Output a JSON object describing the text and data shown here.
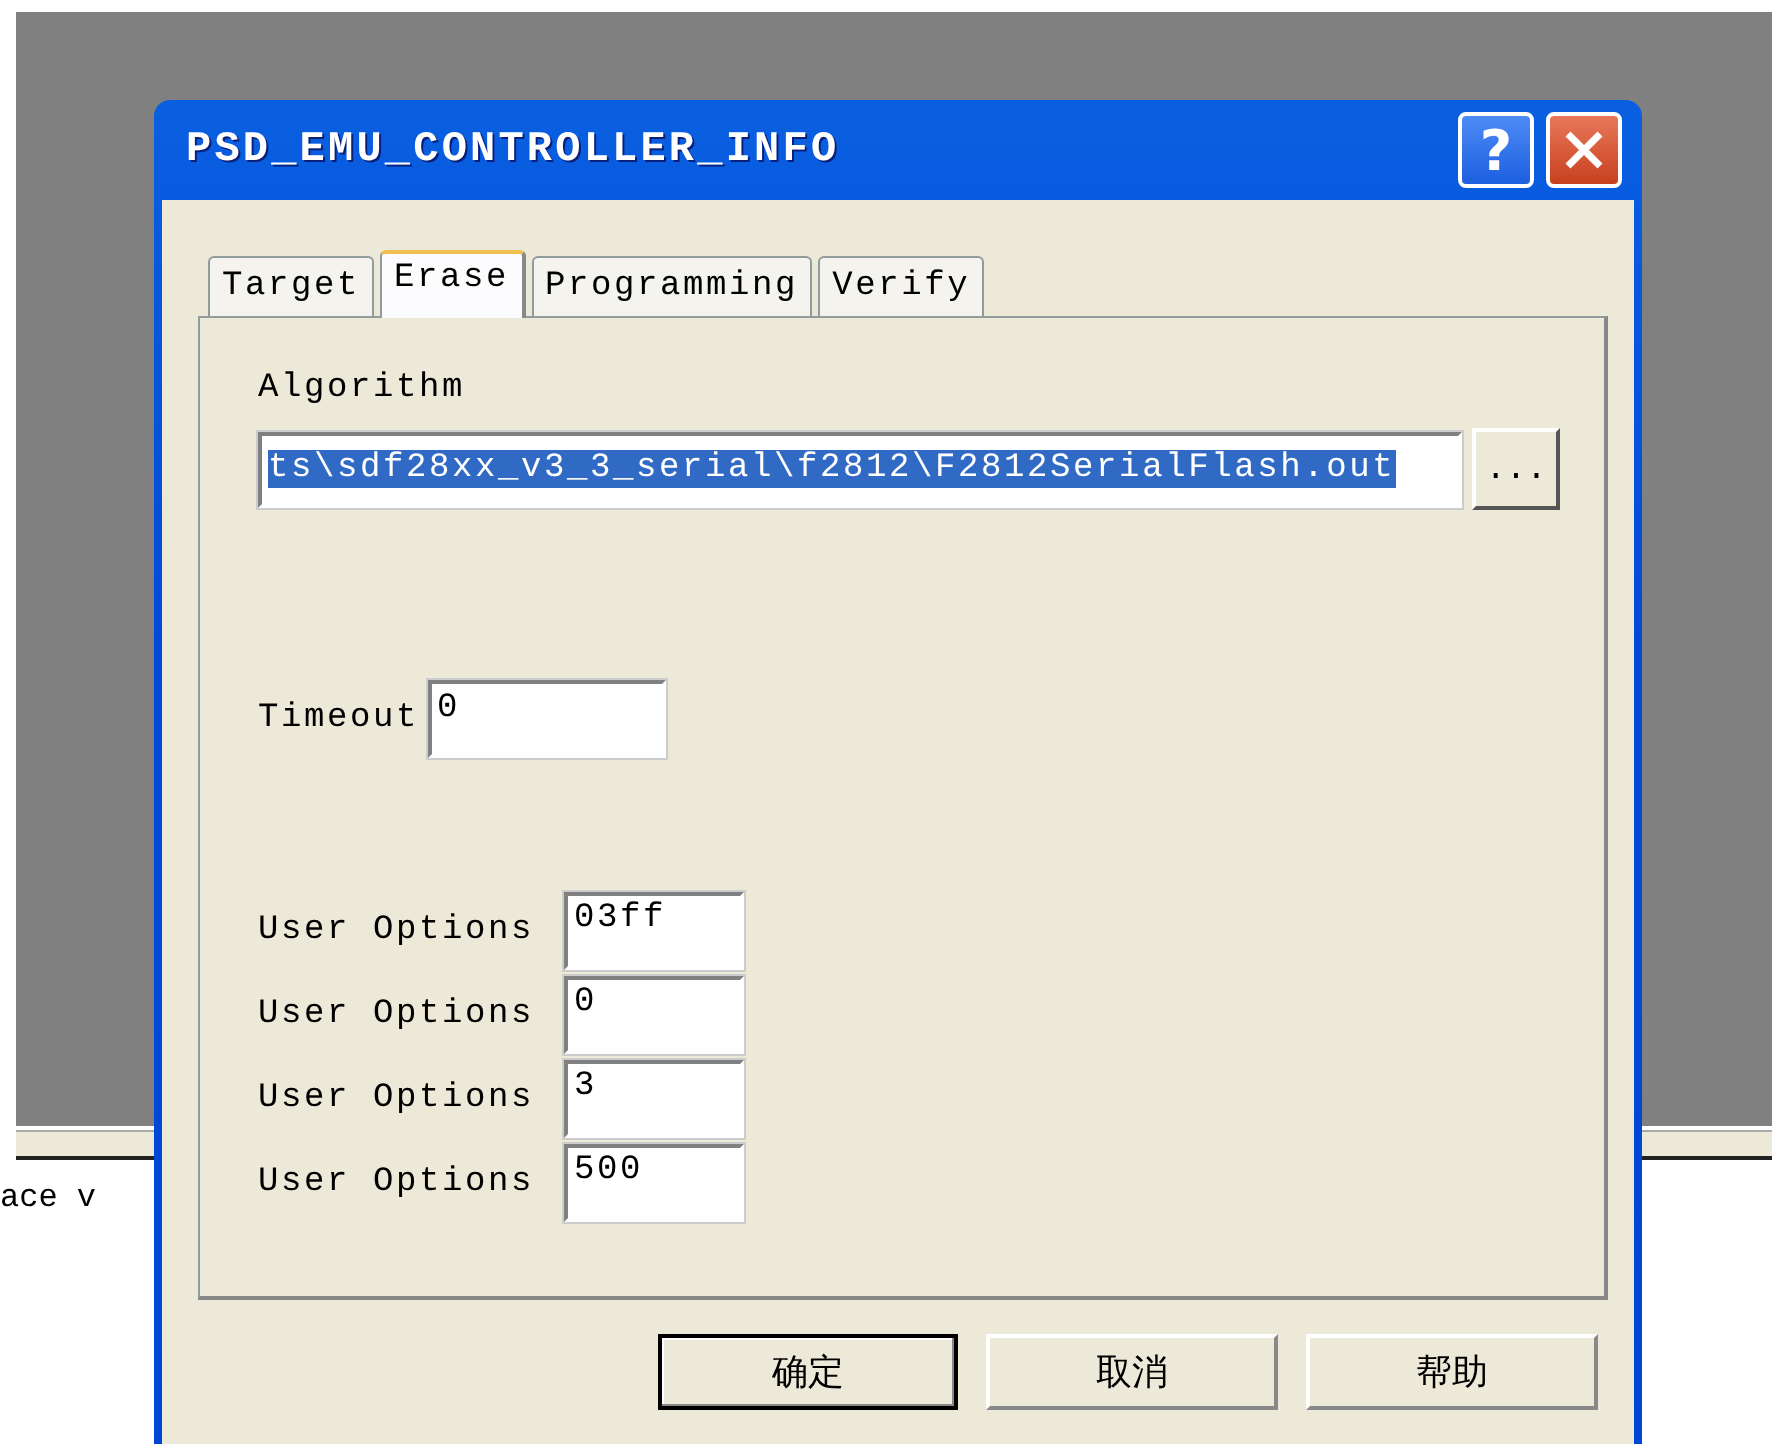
{
  "background": {
    "text": "ace v"
  },
  "window": {
    "title": "PSD_EMU_CONTROLLER_INFO",
    "help": "?"
  },
  "tabs": [
    {
      "label": "Target",
      "selected": false
    },
    {
      "label": "Erase",
      "selected": true
    },
    {
      "label": "Programming",
      "selected": false
    },
    {
      "label": "Verify",
      "selected": false
    }
  ],
  "algorithm": {
    "label": "Algorithm",
    "value": "ts\\sdf28xx_v3_3_serial\\f2812\\F2812SerialFlash.out",
    "text_selected": true,
    "browse": "..."
  },
  "timeout": {
    "label": "Timeout",
    "value": "0"
  },
  "user_options": [
    {
      "label": "User Options",
      "value": "03ff"
    },
    {
      "label": "User Options",
      "value": "0"
    },
    {
      "label": "User Options",
      "value": "3"
    },
    {
      "label": "User Options",
      "value": "500"
    }
  ],
  "buttons": [
    {
      "label": "确定",
      "default": true
    },
    {
      "label": "取消",
      "default": false
    },
    {
      "label": "帮助",
      "default": false
    }
  ]
}
